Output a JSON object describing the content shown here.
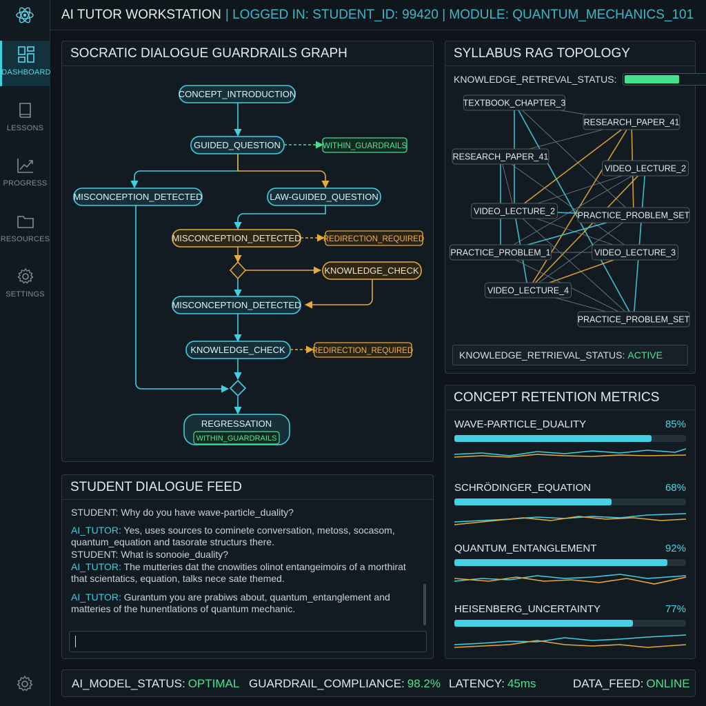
{
  "header": {
    "title": "AI TUTOR WORKSTATION",
    "context": "| LOGGED IN: STUDENT_ID: 99420 | MODULE: QUANTUM_MECHANICS_101"
  },
  "sidebar": {
    "items": [
      {
        "label": "DASHBOARD",
        "icon": "dashboard-icon",
        "active": true
      },
      {
        "label": "LESSONS",
        "icon": "book-icon",
        "active": false
      },
      {
        "label": "PROGRESS",
        "icon": "chart-line-icon",
        "active": false
      },
      {
        "label": "RESOURCES",
        "icon": "folder-icon",
        "active": false
      },
      {
        "label": "SETTINGS",
        "icon": "gear-icon",
        "active": false
      }
    ]
  },
  "graph": {
    "title": "SOCRATIC DIALOGUE GUARDRAILS GRAPH",
    "nodes": {
      "concept_intro": "CONCEPT_INTRODUCTION",
      "guided_question": "GUIDED_QUESTION",
      "within1": "WITHIN_GUARDRAILS",
      "misconception1": "MISCONCEPTION_DETECTED",
      "law_guided": "LAW-GUIDED_QUESTION",
      "misconception2": "MISCONCEPTION_DETECTED",
      "redirect1": "REDIRECTION_REQUIRED",
      "knowledge_check1": "KNOWLEDGE_CHECK",
      "misconception3": "MISCONCEPTION_DETECTED",
      "knowledge_check2": "KNOWLEDGE_CHECK",
      "redirect2": "REDIRECTION_REQUIRED",
      "regression": "REGRESSATION",
      "within2": "WITHIN_GUARDRAILS"
    }
  },
  "rag": {
    "title": "SYLLABUS RAG TOPOLOGY",
    "status_label": "KNOWLEDGE_RETREVAL_STATUS:",
    "status_level": 0.62,
    "nodes": [
      "TEXTBOOK_CHAPTER_3",
      "RESEARCH_PAPER_41",
      "RESEARCH_PAPER_41",
      "VIDEO_LECTURE_2",
      "VIDEO_LECTURE_2",
      "PRACTICE_PROBLEM_SET",
      "PRACTICE_PROBLEM_1",
      "VIDEO_LECTURE_3",
      "VIDEO_LECTURE_4",
      "PRACTICE_PROBLEM_SET"
    ],
    "footer_label": "KNOWLEDGE_RETRIEVAL_STATUS:",
    "footer_value": "ACTIVE"
  },
  "retention": {
    "title": "CONCEPT RETENTION METRICS",
    "metrics": [
      {
        "name": "WAVE-PARTICLE_DUALITY",
        "pct": "85%",
        "value": 0.85
      },
      {
        "name": "SCHRÖDINGER_EQUATION",
        "pct": "68%",
        "value": 0.68
      },
      {
        "name": "QUANTUM_ENTANGLEMENT",
        "pct": "92%",
        "value": 0.92
      },
      {
        "name": "HEISENBERG_UNCERTAINTY",
        "pct": "77%",
        "value": 0.77
      }
    ]
  },
  "dialogue": {
    "title": "STUDENT DIALOGUE FEED",
    "messages": [
      {
        "who": "STUDENT:",
        "text": " Why do you have wave-particle_duality?"
      },
      {
        "who": "AI_TUTOR:",
        "text": " Yes, uses sources to cominete conversation, metoss, socasom, quantum_equation and tasorate structurs there."
      },
      {
        "who": "STUDENT:",
        "text": " What is sonooie_duality?"
      },
      {
        "who": "AI_TUTOR:",
        "text": " The mutteries dat the cnowities olinot entangeimoirs of a morthirat that scientatics, equation, talks nece sate themed."
      },
      {
        "who": "AI_TUTOR:",
        "text": " Gurantum you are prabiws about, quantum_entanglement and matteries of the hunentlations of quantum mechanic."
      }
    ],
    "input_value": ""
  },
  "footer": {
    "model_label": "AI_MODEL_STATUS:",
    "model_value": "OPTIMAL",
    "compliance_label": "GUARDRAIL_COMPLIANCE:",
    "compliance_value": "98.2%",
    "latency_label": "LATENCY:",
    "latency_value": "45ms",
    "feed_label": "DATA_FEED:",
    "feed_value": "ONLINE"
  },
  "colors": {
    "cyan": "#3fd0e4",
    "amber": "#e8a93a",
    "green": "#45e08a",
    "background": "#0e1419"
  }
}
